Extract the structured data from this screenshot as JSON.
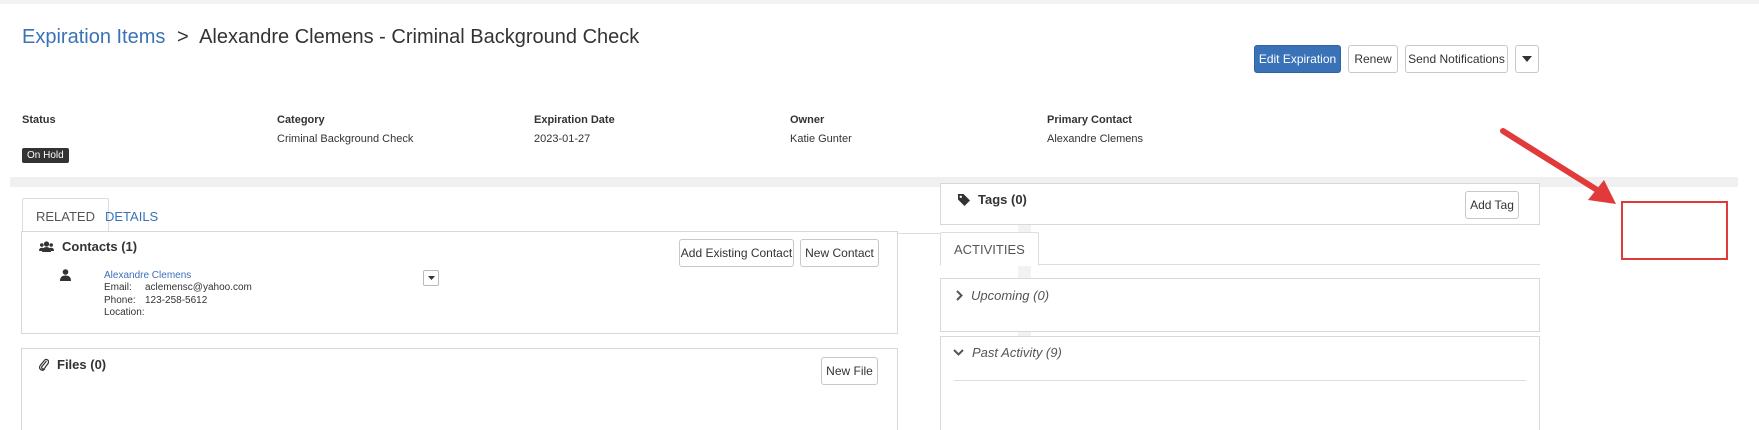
{
  "breadcrumb": {
    "parent": "Expiration Items",
    "separator": ">",
    "current": "Alexandre Clemens - Criminal Background Check"
  },
  "header_actions": {
    "edit": "Edit Expiration",
    "renew": "Renew",
    "send": "Send Notifications",
    "more_icon": "caret-down-icon"
  },
  "summary": {
    "status_label": "Status",
    "status_value": "On Hold",
    "category_label": "Category",
    "category_value": "Criminal Background Check",
    "expiration_label": "Expiration Date",
    "expiration_value": "2023-01-27",
    "owner_label": "Owner",
    "owner_value": "Katie Gunter",
    "primary_label": "Primary Contact",
    "primary_value": "Alexandre Clemens"
  },
  "left_tabs": [
    {
      "label": "RELATED",
      "active": true
    },
    {
      "label": "DETAILS",
      "active": false
    }
  ],
  "contacts": {
    "title": "Contacts (1)",
    "icon": "users-icon",
    "add_existing": "Add Existing Contact",
    "new_contact": "New Contact",
    "person": {
      "icon": "user-icon",
      "name": "Alexandre Clemens",
      "email_label": "Email:",
      "email": "aclemensc@yahoo.com",
      "phone_label": "Phone:",
      "phone": "123-258-5612",
      "location_label": "Location:"
    }
  },
  "files": {
    "title": "Files (0)",
    "icon": "paperclip-icon",
    "new_file": "New File"
  },
  "tags": {
    "title": "Tags (0)",
    "icon": "tag-icon",
    "add_tag": "Add Tag"
  },
  "activities": {
    "tab": "ACTIVITIES",
    "upcoming": "Upcoming (0)",
    "past": "Past Activity (9)"
  },
  "colors": {
    "primary": "#3a72b8",
    "highlight": "#e03a3a",
    "badge_bg": "#333333"
  }
}
